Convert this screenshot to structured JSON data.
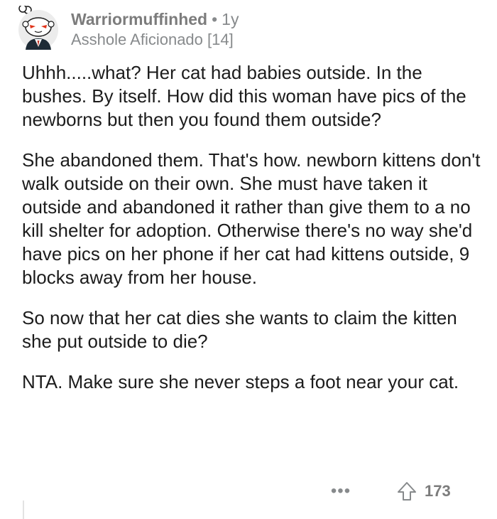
{
  "comment": {
    "username": "Warriormuffinhed",
    "separator": "•",
    "age": "1y",
    "flair": "Asshole Aficionado [14]",
    "avatar_icon": "snoo-avatar-icon",
    "paragraphs": [
      "Uhhh.....what? Her cat had babies outside. In the bushes. By itself. How did this woman have pics of the newborns but then you found them outside?",
      "She abandoned them. That's how. newborn kittens don't walk outside on their own. She must have taken it outside and abandoned it rather than give them to a no kill shelter for adoption. Otherwise there's no way she'd have pics on her phone if her cat had kittens outside, 9 blocks away from her house.",
      "So now that her cat dies she wants to claim the kitten she put outside to die?",
      "NTA. Make sure she never steps a foot near your cat."
    ],
    "actions": {
      "more_label": "•••",
      "upvote_icon": "upvote-arrow-icon",
      "score": "173"
    }
  },
  "colors": {
    "text": "#1c1c1c",
    "meta": "#878a8c",
    "username": "#7c7c7c",
    "avatar_red": "#e0341a",
    "background": "#ffffff"
  }
}
